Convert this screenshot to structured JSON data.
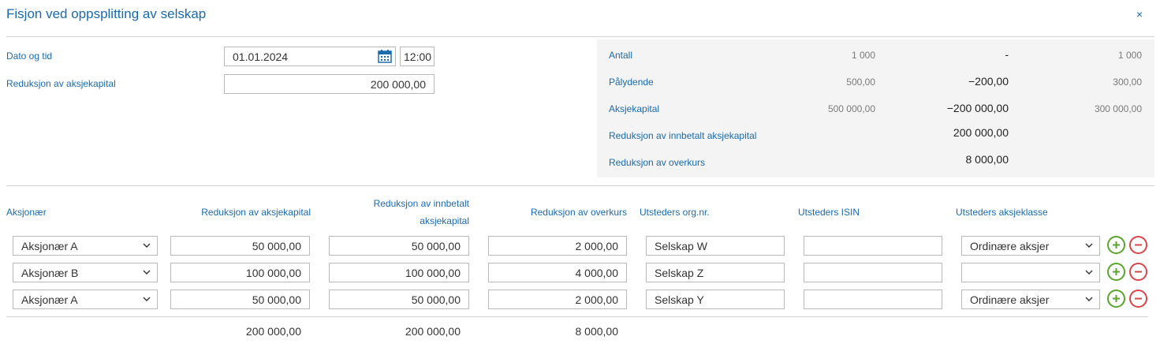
{
  "dialog": {
    "title": "Fisjon ved oppsplitting av selskap",
    "close": "×"
  },
  "form": {
    "date_label": "Dato og tid",
    "date_value": "01.01.2024",
    "time_value": "12:00",
    "reduction_label": "Reduksjon av aksjekapital",
    "reduction_value": "200 000,00"
  },
  "summary": {
    "rows": [
      {
        "label": "Antall",
        "before": "1 000",
        "change": "-",
        "after": "1 000"
      },
      {
        "label": "Pålydende",
        "before": "500,00",
        "change": "−200,00",
        "after": "300,00"
      },
      {
        "label": "Aksjekapital",
        "before": "500 000,00",
        "change": "−200 000,00",
        "after": "300 000,00"
      },
      {
        "label": "Reduksjon av innbetalt aksjekapital",
        "before": "",
        "change": "200 000,00",
        "after": ""
      },
      {
        "label": "Reduksjon av overkurs",
        "before": "",
        "change": "8 000,00",
        "after": ""
      }
    ]
  },
  "table": {
    "headers": {
      "shareholder": "Aksjonær",
      "capital_reduction": "Reduksjon av aksjekapital",
      "paid_in_line1": "Reduksjon av innbetalt",
      "paid_in_line2": "aksjekapital",
      "premium": "Reduksjon av overkurs",
      "org_nr": "Utsteders org.nr.",
      "isin": "Utsteders ISIN",
      "share_class": "Utsteders aksjeklasse"
    },
    "rows": [
      {
        "shareholder": "Aksjonær A",
        "capital": "50 000,00",
        "paid_in": "50 000,00",
        "premium": "2 000,00",
        "org_nr": "Selskap W",
        "isin": "",
        "share_class": "Ordinære aksjer"
      },
      {
        "shareholder": "Aksjonær B",
        "capital": "100 000,00",
        "paid_in": "100 000,00",
        "premium": "4 000,00",
        "org_nr": "Selskap Z",
        "isin": "",
        "share_class": ""
      },
      {
        "shareholder": "Aksjonær A",
        "capital": "50 000,00",
        "paid_in": "50 000,00",
        "premium": "2 000,00",
        "org_nr": "Selskap Y",
        "isin": "",
        "share_class": "Ordinære aksjer"
      }
    ],
    "totals": {
      "capital": "200 000,00",
      "paid_in": "200 000,00",
      "premium": "8 000,00"
    }
  },
  "icons": {
    "close": "close-icon",
    "calendar": "calendar-icon",
    "chevron": "chevron-down-icon",
    "add": "plus-circle-icon",
    "remove": "minus-circle-icon"
  },
  "colors": {
    "accent": "#1a6aae",
    "add": "#5aa52c",
    "remove": "#d9464a",
    "summary_bg": "#f4f4f4"
  }
}
